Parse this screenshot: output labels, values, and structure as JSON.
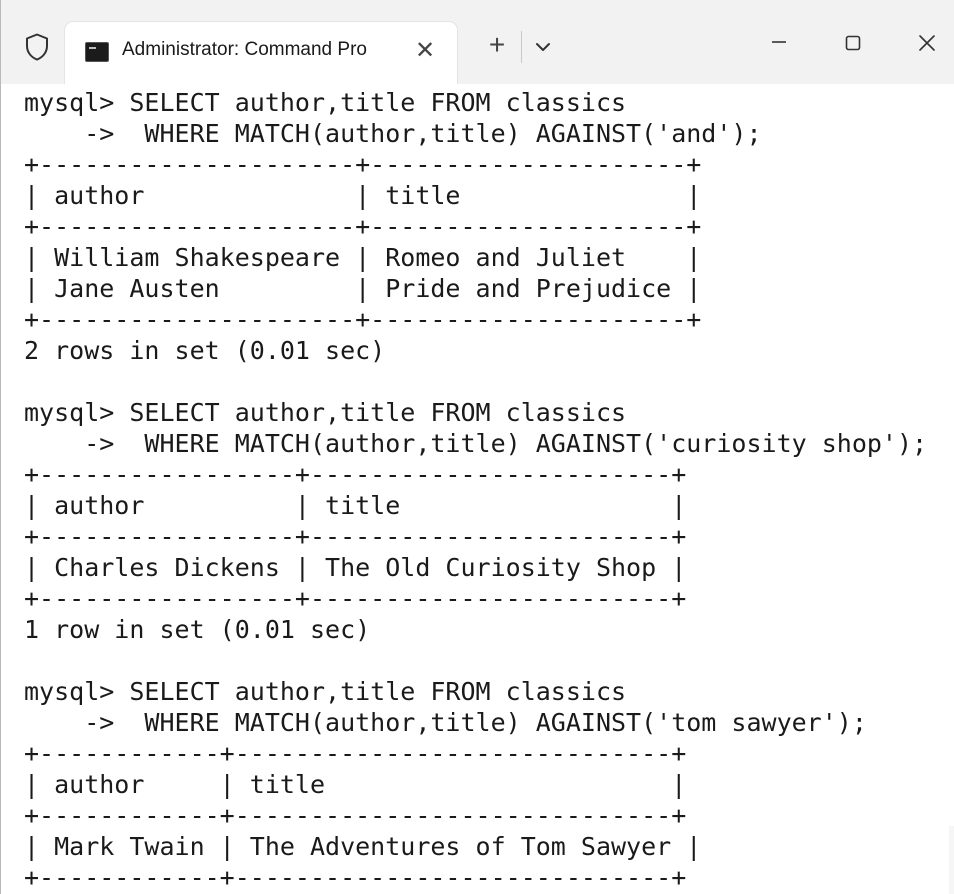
{
  "window": {
    "tab_title": "Administrator: Command Pro",
    "tab_close": "✕",
    "new_tab": "+"
  },
  "icons": {
    "shield": "shield-icon",
    "terminal": "terminal-icon",
    "dropdown": "chevron-down-icon",
    "minimize": "minimize-icon",
    "maximize": "maximize-icon",
    "close": "close-icon"
  },
  "console": {
    "lines": [
      "mysql> SELECT author,title FROM classics",
      "    ->  WHERE MATCH(author,title) AGAINST('and');",
      "+---------------------+---------------------+",
      "| author              | title               |",
      "+---------------------+---------------------+",
      "| William Shakespeare | Romeo and Juliet    |",
      "| Jane Austen         | Pride and Prejudice |",
      "+---------------------+---------------------+",
      "2 rows in set (0.01 sec)",
      "",
      "mysql> SELECT author,title FROM classics",
      "    ->  WHERE MATCH(author,title) AGAINST('curiosity shop');",
      "+-----------------+------------------------+",
      "| author          | title                  |",
      "+-----------------+------------------------+",
      "| Charles Dickens | The Old Curiosity Shop |",
      "+-----------------+------------------------+",
      "1 row in set (0.01 sec)",
      "",
      "mysql> SELECT author,title FROM classics",
      "    ->  WHERE MATCH(author,title) AGAINST('tom sawyer');",
      "+------------+-----------------------------+",
      "| author     | title                       |",
      "+------------+-----------------------------+",
      "| Mark Twain | The Adventures of Tom Sawyer |",
      "+------------+-----------------------------+"
    ]
  }
}
